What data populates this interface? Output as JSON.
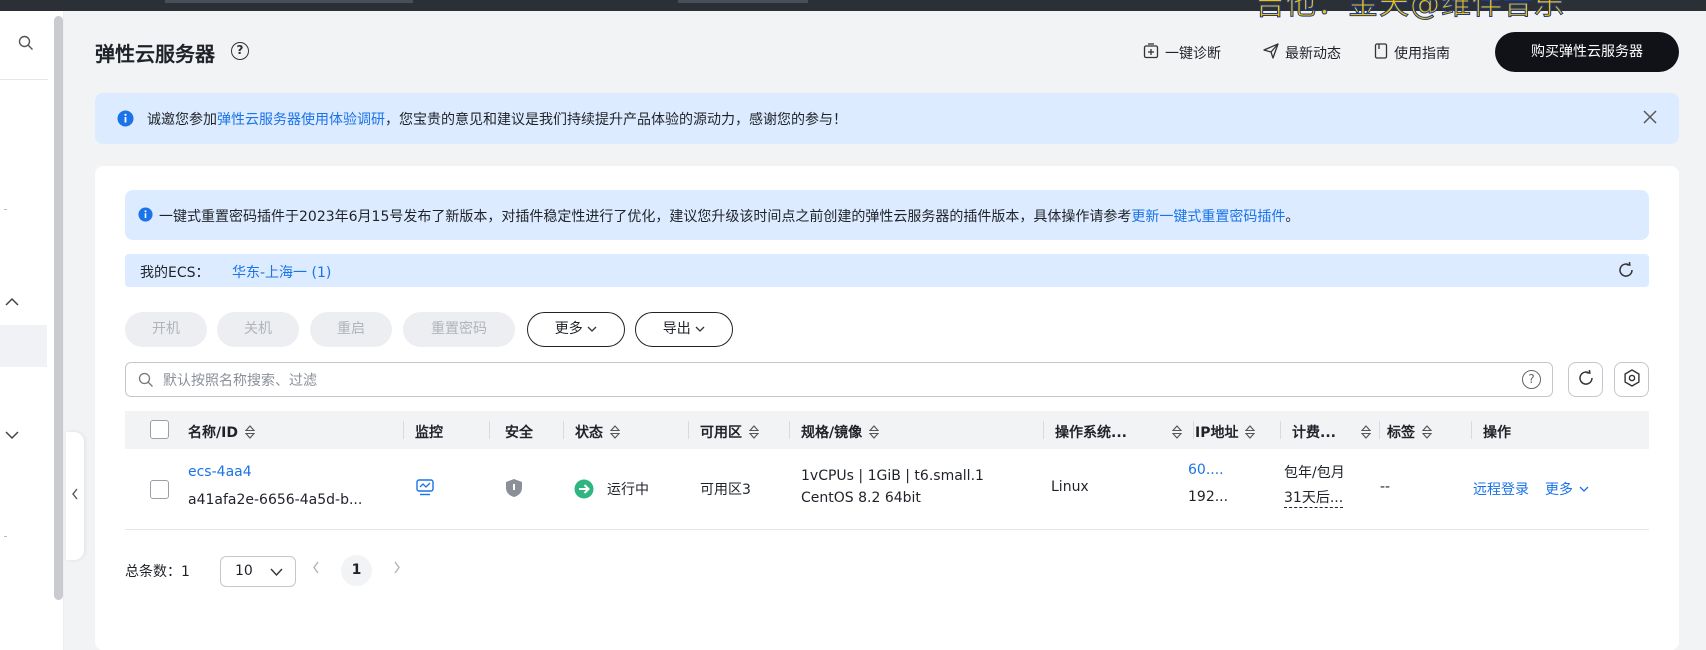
{
  "watermark": {
    "text": "吉他：金天@维伴音乐"
  },
  "header": {
    "title": "弹性云服务器",
    "links": [
      {
        "label": "一键诊断",
        "icon": "diagnose-icon"
      },
      {
        "label": "最新动态",
        "icon": "send-icon"
      },
      {
        "label": "使用指南",
        "icon": "guide-book-icon"
      }
    ],
    "buy_button": "购买弹性云服务器"
  },
  "notice_survey": {
    "prefix": "诚邀您参加",
    "link": "弹性云服务器使用体验调研",
    "suffix": "，您宝贵的意见和建议是我们持续提升产品体验的源动力，感谢您的参与！"
  },
  "notice_plugin": {
    "text": "一键式重置密码插件于2023年6月15号发布了新版本，对插件稳定性进行了优化，建议您升级该时间点之前创建的弹性云服务器的插件版本，具体操作请参考",
    "link": "更新一键式重置密码插件",
    "end": "。"
  },
  "region_bar": {
    "label": "我的ECS：",
    "region": "华东-上海一 (1)"
  },
  "actions": {
    "start": "开机",
    "stop": "关机",
    "restart": "重启",
    "reset_password": "重置密码",
    "more": "更多",
    "export": "导出"
  },
  "search": {
    "placeholder": "默认按照名称搜索、过滤"
  },
  "table": {
    "columns": {
      "name": "名称/ID",
      "monitor": "监控",
      "security": "安全",
      "status": "状态",
      "az": "可用区",
      "spec": "规格/镜像",
      "os": "操作系统...",
      "ip": "IP地址",
      "billing": "计费...",
      "tags": "标签",
      "ops": "操作"
    },
    "rows": [
      {
        "name": "ecs-4aa4",
        "id": "a41afa2e-6656-4a5d-b...",
        "status": "运行中",
        "az": "可用区3",
        "spec": "1vCPUs | 1GiB | t6.small.1",
        "image": "CentOS 8.2 64bit",
        "os": "Linux",
        "ip_public": "60....",
        "ip_private": "192...",
        "billing_mode": "包年/包月",
        "billing_expire": "31天后...",
        "tags": "--",
        "remote_login": "远程登录",
        "more": "更多"
      }
    ]
  },
  "pagination": {
    "total_label": "总条数：",
    "total": "1",
    "page_size": "10",
    "current_page": "1"
  },
  "colors": {
    "accent": "#1a73e8",
    "notice_bg": "#dcebff",
    "running": "#2fb57e",
    "primary_button": "#111217"
  }
}
